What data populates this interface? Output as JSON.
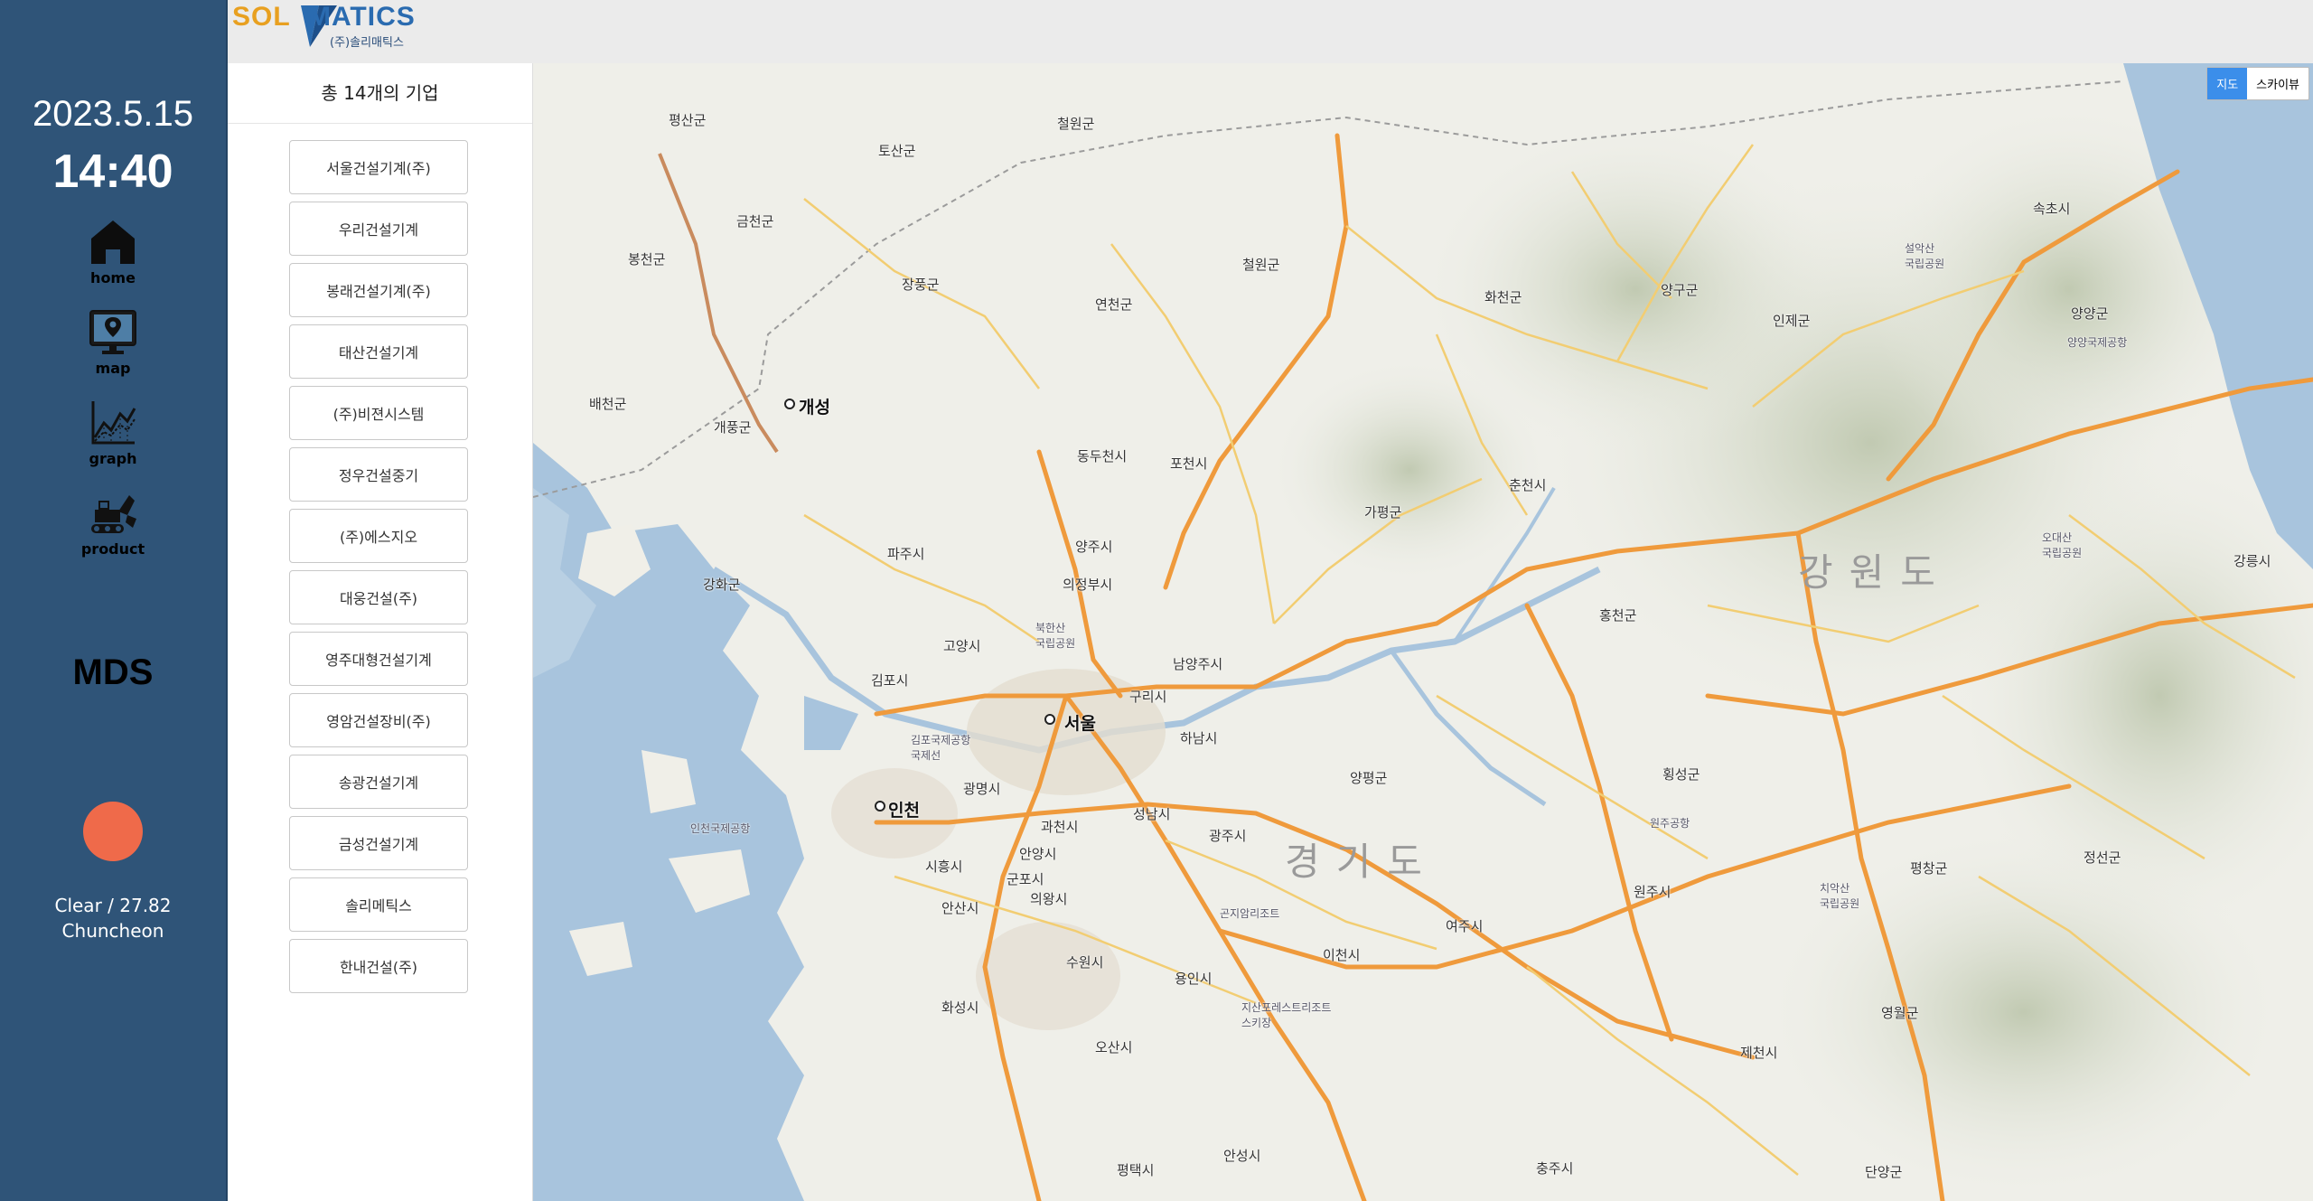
{
  "sidebar": {
    "date": "2023.5.15",
    "time": "14:40",
    "nav": [
      {
        "label": "home",
        "icon": "home-icon"
      },
      {
        "label": "map",
        "icon": "map-icon"
      },
      {
        "label": "graph",
        "icon": "graph-icon"
      },
      {
        "label": "product",
        "icon": "excavator-icon"
      }
    ],
    "device_name": "MDS",
    "status_color": "#ef6a4a",
    "weather": "Clear / 27.82",
    "city": "Chuncheon"
  },
  "header": {
    "logo_text_a": "SOL",
    "logo_text_b": "MATICS",
    "logo_sub": "(주)솔리매틱스"
  },
  "company_list": {
    "title": "총 14개의 기업",
    "items": [
      "서울건설기계(주)",
      "우리건설기계",
      "봉래건설기계(주)",
      "태산건설기계",
      "(주)비젼시스템",
      "정우건설중기",
      "(주)에스지오",
      "대웅건설(주)",
      "영주대형건설기계",
      "영암건설장비(주)",
      "송광건설기계",
      "금성건설기계",
      "솔리메틱스",
      "한내건설(주)"
    ]
  },
  "map": {
    "toggle_map": "지도",
    "toggle_sky": "스카이뷰",
    "labels": {
      "seoul": "서울",
      "incheon": "인천",
      "gaeseong": "개성",
      "gyeonggi": "경기도",
      "gangwon": "강원도",
      "chuncheon": "춘천시",
      "pyeongsan": "평산군",
      "toesan": "토산군",
      "cheorwon": "철원군",
      "geumcheon": "금천군",
      "bongcheon": "봉천군",
      "jangpung": "장풍군",
      "yeoncheon": "연천군",
      "cheorwon2": "철원군",
      "hwacheon": "화천군",
      "yanggu": "양구군",
      "inje": "인제군",
      "sokcho": "속초시",
      "yangyang": "양양군",
      "baecheon": "배천군",
      "gaepung": "개풍군",
      "dongducheon": "동두천시",
      "pocheon": "포천시",
      "gapyeong": "가평군",
      "paju": "파주시",
      "yangju": "양주시",
      "uijeongbu": "의정부시",
      "ganghwa": "강화군",
      "gimpo": "김포시",
      "goyang": "고양시",
      "guri": "구리시",
      "namyangju": "남양주시",
      "hanam": "하남시",
      "hongcheon": "홍천군",
      "gangneung": "강릉시",
      "gwangmyeong": "광명시",
      "gwacheon": "과천시",
      "seongnam": "성남시",
      "gwangju": "광주시",
      "yangpyeong": "양평군",
      "hoengseong": "횡성군",
      "wonju": "원주시",
      "pyeongchang": "평창군",
      "jeongseon": "정선군",
      "siheung": "시흥시",
      "anyang": "안양시",
      "gunpo": "군포시",
      "uiwang": "의왕시",
      "ansan": "안산시",
      "suwon": "수원시",
      "yongin": "용인시",
      "icheon": "이천시",
      "yeoju": "여주시",
      "hwaseong": "화성시",
      "osan": "오산시",
      "yeongwol": "영월군",
      "jecheon": "제천시",
      "pyeongtaek": "평택시",
      "anseong": "안성시",
      "chungju": "충주시",
      "danyang": "단양군",
      "odaesan": "오대산\n국립공원",
      "seoraksan": "설악산\n국립공원",
      "chiaksan": "치악산\n국립공원",
      "incheon_airport": "인천국제공항",
      "gimpo_airport": "김포국제공항\n국제선",
      "wonju_airport": "원주공항",
      "yangyang_airport": "양양국제공항",
      "jisan": "지산포레스트리조트\n스키장",
      "gonjiam": "곤지암리조트",
      "bukhansan": "북한산\n국립공원"
    }
  }
}
